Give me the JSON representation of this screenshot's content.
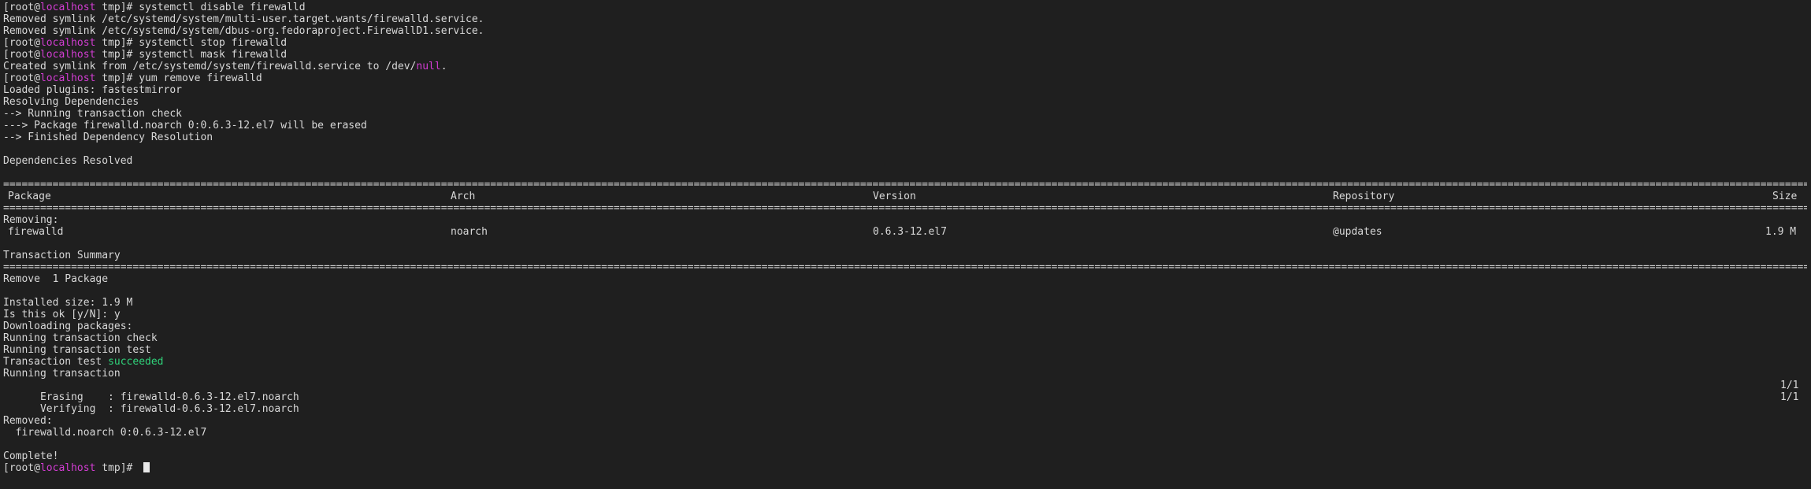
{
  "prompt": {
    "user": "[root@",
    "host": "localhost",
    "tail": " tmp]# "
  },
  "lines": {
    "cmd1": "systemctl disable firewalld",
    "out1": "Removed symlink /etc/systemd/system/multi-user.target.wants/firewalld.service.",
    "out2": "Removed symlink /etc/systemd/system/dbus-org.fedoraproject.FirewallD1.service.",
    "cmd2": "systemctl stop firewalld",
    "cmd3": "systemctl mask firewalld",
    "out3a": "Created symlink from /etc/systemd/system/firewalld.service to /dev/",
    "out3b": "null",
    "out3c": ".",
    "cmd4": "yum remove firewalld",
    "out4": "Loaded plugins: fastestmirror",
    "out5": "Resolving Dependencies",
    "out6": "--> Running transaction check",
    "out7": "---> Package firewalld.noarch 0:0.6.3-12.el7 will be erased",
    "out8": "--> Finished Dependency Resolution",
    "out9": "Dependencies Resolved",
    "separator": "======================================================================================================================================================================================================================================================================================================================================================"
  },
  "table": {
    "headers": [
      "Package",
      "Arch",
      "Version",
      "Repository",
      "Size"
    ],
    "section": "Removing:",
    "rows": [
      [
        "firewalld",
        "noarch",
        "0.6.3-12.el7",
        "@updates",
        "1.9 M"
      ]
    ]
  },
  "summary": {
    "title": "Transaction Summary",
    "remove": "Remove  1 Package",
    "installed_size": "Installed size: 1.9 M",
    "confirm": "Is this ok [y/N]: y",
    "downloading": "Downloading packages:",
    "check": "Running transaction check",
    "test": "Running transaction test",
    "test_result_label": "Transaction test ",
    "test_result_value": "succeeded",
    "running": "Running transaction",
    "erasing": "  Erasing    : firewalld-0.6.3-12.el7.noarch",
    "erasing_count": "1/1",
    "verifying": "  Verifying  : firewalld-0.6.3-12.el7.noarch",
    "verifying_count": "1/1",
    "removed_label": "Removed:",
    "removed_pkg": "  firewalld.noarch 0:0.6.3-12.el7",
    "complete": "Complete!"
  },
  "colors": {
    "background": "#1f1f1f",
    "text": "#d8d8d8",
    "hostname": "#d23dd2",
    "success": "#2fd27a"
  }
}
